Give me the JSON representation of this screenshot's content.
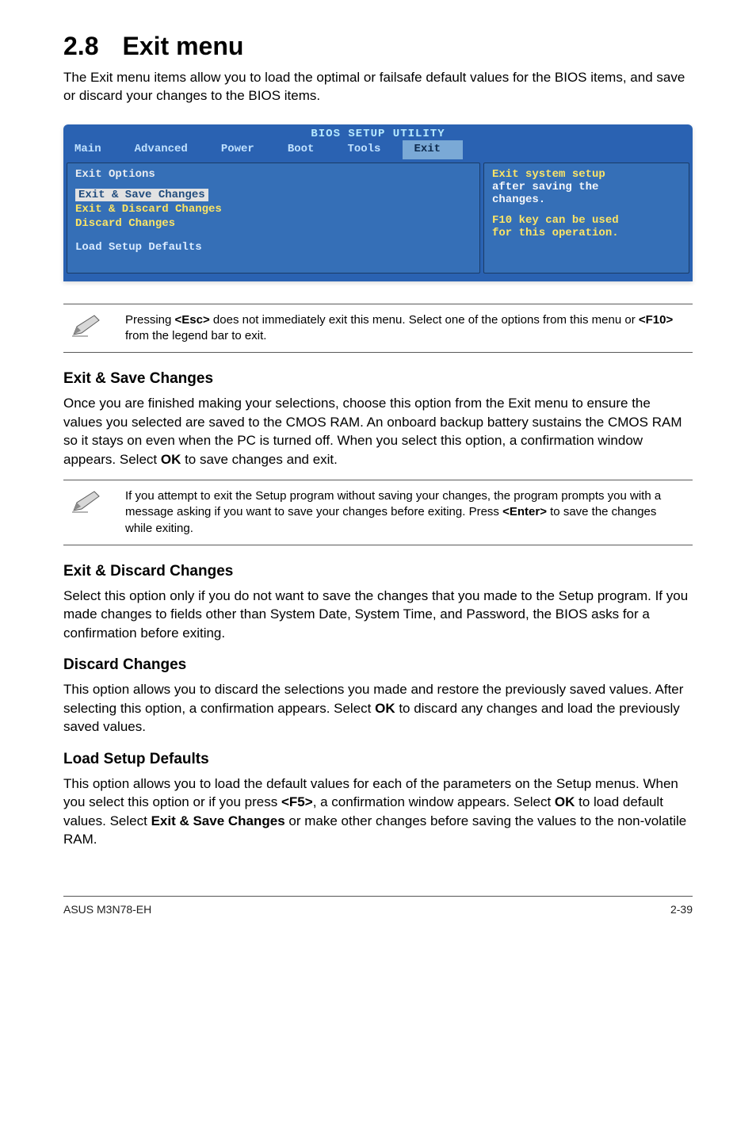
{
  "heading": {
    "number": "2.8",
    "title": "Exit menu"
  },
  "intro": "The Exit menu items allow you to load the optimal or failsafe default values for the BIOS items, and save or discard your changes to the BIOS items.",
  "bios": {
    "utility_title": "BIOS SETUP UTILITY",
    "tabs": {
      "main": "Main",
      "advanced": "Advanced",
      "power": "Power",
      "boot": "Boot",
      "tools": "Tools",
      "exit": "Exit"
    },
    "left": {
      "header": "Exit Options",
      "selected": "Exit & Save Changes",
      "lines_yellow": [
        "Exit & Discard Changes",
        "Discard Changes"
      ],
      "line_blue": "Load Setup Defaults"
    },
    "right": {
      "l1": "Exit system setup",
      "l2": "after saving the",
      "l3": "changes.",
      "l4": "F10 key can be used",
      "l5": "for this operation."
    }
  },
  "note1": {
    "p1a": "Pressing ",
    "p1b": "<Esc>",
    "p1c": " does not immediately exit this menu. Select one of the options from this menu or ",
    "p1d": "<F10>",
    "p1e": " from the legend bar to exit."
  },
  "saveChanges": {
    "title": "Exit & Save Changes",
    "body_a": "Once you are finished making your selections, choose this option from the Exit menu to ensure the values you selected are saved to the CMOS RAM. An onboard backup battery sustains the CMOS RAM so it stays on even when the PC is turned off. When you select this option, a confirmation window appears. Select ",
    "body_ok": "OK",
    "body_b": " to save changes and exit."
  },
  "note2": {
    "p1": " If you attempt to exit the Setup program without saving your changes, the program prompts you with a message asking if you want to save your changes before exiting. Press ",
    "enter": "<Enter>",
    "p2": " to save the  changes while exiting."
  },
  "discardExit": {
    "title": "Exit & Discard Changes",
    "body": "Select this option only if you do not want to save the changes that you  made to the Setup program. If you made changes to fields other than System Date, System Time, and Password, the BIOS asks for a confirmation before exiting."
  },
  "discard": {
    "title": "Discard Changes",
    "body_a": "This option allows you to discard the selections you made and restore the previously saved values. After selecting this option, a confirmation appears. Select ",
    "body_ok": "OK",
    "body_b": " to discard any changes and load the previously saved values."
  },
  "loadDefaults": {
    "title": "Load Setup Defaults",
    "body_a": "This option allows you to load the default values for each of the parameters on the Setup menus. When you select this option or if you press ",
    "f5": "<F5>",
    "body_b": ", a confirmation window appears. Select ",
    "ok": "OK",
    "body_c": " to load default values. Select ",
    "exitSave": "Exit & Save Changes",
    "body_d": " or make other changes before saving the values to the non-volatile RAM."
  },
  "footer": {
    "left": "ASUS M3N78-EH",
    "right": "2-39"
  }
}
